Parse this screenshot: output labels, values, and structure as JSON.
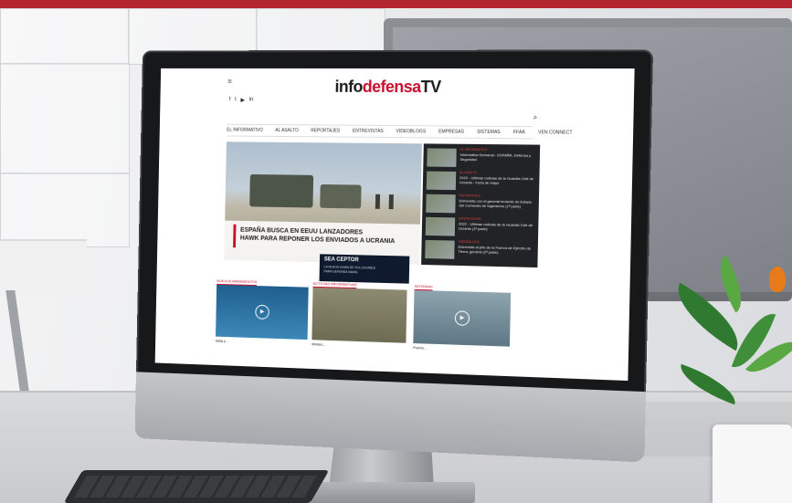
{
  "site": {
    "logo_part1": "info",
    "logo_part2": "defensa",
    "logo_part3": "TV",
    "tagline": "",
    "menu_icon": "hamburger-icon",
    "search_icon": "search-icon",
    "social_icons": [
      "facebook-icon",
      "twitter-icon",
      "youtube-icon",
      "linkedin-icon"
    ]
  },
  "nav": {
    "items": [
      "EL INFORMATIVO",
      "AL ASALTO",
      "REPORTAJES",
      "ENTREVISTAS",
      "VIDEOBLOGS",
      "EMPRESAS",
      "SISTEMAS",
      "FFAA",
      "VEN CONNECT"
    ]
  },
  "hero": {
    "headline_line1": "ESPAÑA BUSCA EN EEUU LANZADORES",
    "headline_line2": "HAWK PARA REPONER LOS ENVIADOS A UCRANIA"
  },
  "sidebar_news": [
    {
      "cat": "EL INFORMATIVO",
      "text": "Informativo Semanal - ESPAÑA, Defensa y Seguridad"
    },
    {
      "cat": "AL ASALTO",
      "text": "2023 - Ultimas noticias de la Guardia Civil de Ucrania - Feria de mayo"
    },
    {
      "cat": "REPORTAJES",
      "text": "Entrevista con el general teniente de Estado del Comando de Ingenieros (1ª parte)"
    },
    {
      "cat": "ENTREVISTAS",
      "text": "2022 - Ultimas noticias de la Guardia Civil de Ucrania (1ª parte)"
    },
    {
      "cat": "VIDEOBLOGS",
      "text": "Entrevista al jefe de la Fuerza de Ejército de Tierra, general (2ª parte)"
    }
  ],
  "ad": {
    "title": "SEA CEPTOR",
    "subtitle": "LA NUEVA GAMA DE SOLUCIONES PARA DEFENSA NAVAL"
  },
  "cards": [
    {
      "cat": "NUEVOS ARMAMENTOS",
      "title": "Italia y...",
      "bg": "#2b6f9c"
    },
    {
      "cat": "NOTICIAS INFORMATIVAS",
      "title": "Misiles...",
      "bg": "#8f8a6e"
    },
    {
      "cat": "SISTEMAS",
      "title": "Puerto...",
      "bg": "#6f8793"
    }
  ],
  "colors": {
    "brand_red": "#c8102e",
    "top_bar": "#b3252f"
  }
}
